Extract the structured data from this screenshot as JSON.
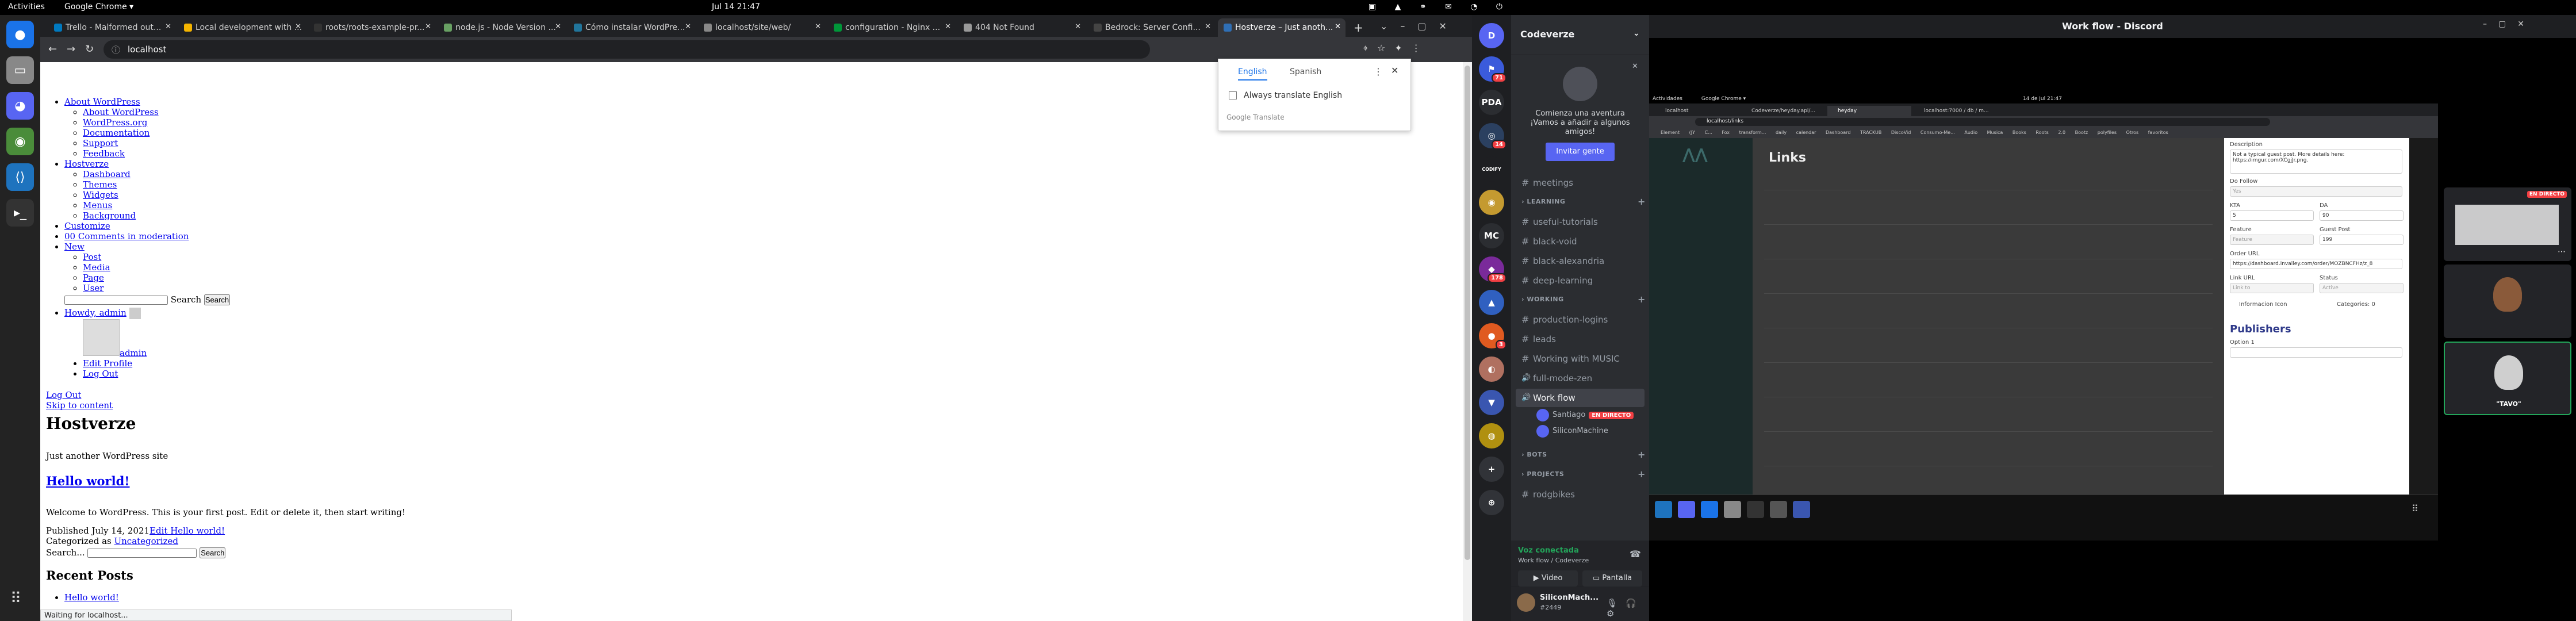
{
  "topbar": {
    "activities": "Activities",
    "app": "Google Chrome ▾",
    "clock": "Jul 14  21:47",
    "tray": "▣ ▲ ⚭ ✉ ◔ ⏻"
  },
  "dock": {
    "items": [
      "chrome-icon",
      "files-icon",
      "discord-icon",
      "vscode-icon",
      "terminal-icon"
    ]
  },
  "browser": {
    "tabs": [
      "Trello - Malformed out...",
      "Local development with ...",
      "roots/roots-example-pr...",
      "node.js - Node Version ...",
      "Cómo instalar WordPre...",
      "localhost/site/web/",
      "configuration - Nginx ...",
      "404 Not Found",
      "Bedrock: Server Confi...",
      "Hostverze – Just anoth..."
    ],
    "url": "localhost",
    "status": "Waiting for localhost..."
  },
  "translate": {
    "tab1": "English",
    "tab2": "Spanish",
    "always": "Always translate English",
    "brand": "Google Translate"
  },
  "wp": {
    "adminbar": [
      {
        "label": "About WordPress",
        "children": [
          "About WordPress",
          "WordPress.org",
          "Documentation",
          "Support",
          "Feedback"
        ]
      },
      {
        "label": "Hostverze",
        "children": [
          "Dashboard",
          "Themes",
          "Widgets",
          "Menus",
          "Background"
        ]
      },
      {
        "label": "Customize",
        "children": []
      },
      {
        "label": "00 Comments in moderation",
        "children": []
      },
      {
        "label": "New",
        "children": [
          "Post",
          "Media",
          "Page",
          "User"
        ]
      }
    ],
    "search_label": "Search",
    "search_btn": "Search",
    "howdy": "Howdy, admin",
    "user_admin": "admin",
    "edit_profile": "Edit Profile",
    "logout": "Log Out",
    "logout2": "Log Out",
    "skip": "Skip to content",
    "site_title": "Hostverze",
    "tagline": "Just another WordPress site",
    "post_title": "Hello world!",
    "post_body": "Welcome to WordPress. This is your first post. Edit or delete it, then start writing!",
    "published": "Published July 14, 2021",
    "edit_post": "Edit Hello world!",
    "categorized": "Categorized as",
    "category": "Uncategorized",
    "search_label2": "Search...",
    "search_btn2": "Search",
    "recent_heading": "Recent Posts",
    "recent_items": [
      "Hello world!"
    ]
  },
  "discord": {
    "title": "Work flow - Discord",
    "server_name": "Codeverze",
    "invite_text": "Comienza una aventura ¡Vamos a añadir a algunos amigos!",
    "invite_btn": "Invitar gente",
    "servers": [
      {
        "label": "D",
        "color": "#5865f2",
        "badge": ""
      },
      {
        "label": "⚑",
        "color": "#3b5bdb",
        "badge": "71"
      },
      {
        "label": "PDA",
        "color": "#2b2d31",
        "badge": ""
      },
      {
        "label": "◎",
        "color": "#2b4060",
        "badge": "14"
      },
      {
        "label": "CODIFY",
        "color": "#1e1f22",
        "badge": ""
      },
      {
        "label": "◉",
        "color": "#c49a30",
        "badge": ""
      },
      {
        "label": "MC",
        "color": "#2b2d31",
        "badge": ""
      },
      {
        "label": "◆",
        "color": "#7a2a9a",
        "badge": "178"
      },
      {
        "label": "▲",
        "color": "#3060c0",
        "badge": ""
      },
      {
        "label": "●",
        "color": "#e05a20",
        "badge": "3"
      },
      {
        "label": "◐",
        "color": "#b07060",
        "badge": ""
      },
      {
        "label": "▼",
        "color": "#3a56b0",
        "badge": ""
      },
      {
        "label": "◍",
        "color": "#b09010",
        "badge": ""
      },
      {
        "label": "+",
        "color": "#313338",
        "badge": ""
      },
      {
        "label": "⊕",
        "color": "#313338",
        "badge": ""
      }
    ],
    "top_channel": "meetings",
    "cat_learning": "LEARNING",
    "learning": [
      "useful-tutorials",
      "black-void",
      "black-alexandria",
      "deep-learning"
    ],
    "cat_working": "WORKING",
    "working": [
      "production-logins",
      "leads",
      "Working with MUSIC",
      "full-mode-zen",
      "Work flow"
    ],
    "voice_users": [
      {
        "name": "Santiago",
        "live": "EN DIRECTO"
      },
      {
        "name": "SiliconMachine",
        "live": ""
      }
    ],
    "cat_bots": "BOTS",
    "cat_projects": "PROJECTS",
    "projects": [
      "rodgbikes"
    ],
    "voice_connected": "Voz conectada",
    "voice_sub": "Work flow / Codeverze",
    "video_btn": "Video",
    "screen_btn": "Pantalla",
    "username": "SiliconMach...",
    "usertag": "#2449",
    "stage_tiles": [
      {
        "name": "",
        "live": "EN DIRECTO"
      },
      {
        "name": "",
        "live": ""
      },
      {
        "name": "\"TAVO\"",
        "live": ""
      }
    ]
  },
  "shared": {
    "activities": "Actividades",
    "app": "Google Chrome ▾",
    "clock": "14 de jul  21:47",
    "tabs": [
      "localhost",
      "Codeverze/heyday.api/...",
      "heyday",
      "localhost:7000 / db / m..."
    ],
    "url": "localhost/links",
    "bookmarks": "Element (JY C... Fox transform... daily calendar Dashboard TRACKUB DiscoVid Consumo-Me... Audio Musica Books Roots 2.0 Bootz polyfiles Otros favoritos",
    "page_title": "Links",
    "panel": {
      "desc_label": "Description",
      "desc_value": "Not a typical guest post. More details here: https://imgur.com/XCgjJr.png.",
      "dofollow_label": "Do Follow",
      "dofollow_value": "Yes",
      "kta_label": "KTA",
      "kta_value": "5",
      "da_label": "DA",
      "da_value": "90",
      "feature_label": "Feature",
      "feature_value": "Feature",
      "guestpost_label": "Guest Post",
      "guestpost_value": "199",
      "order_label": "Order URL",
      "order_value": "https://dashboard.invalley.com/order/MOZBNCFHz/z_8",
      "link_label": "Link URL",
      "link_value": "Link to",
      "status_label": "Status",
      "status_value": "Active",
      "info_label": "Informacion Icon",
      "cat_label": "Categories: 0",
      "publishers": "Publishers",
      "option_label": "Option 1"
    }
  }
}
